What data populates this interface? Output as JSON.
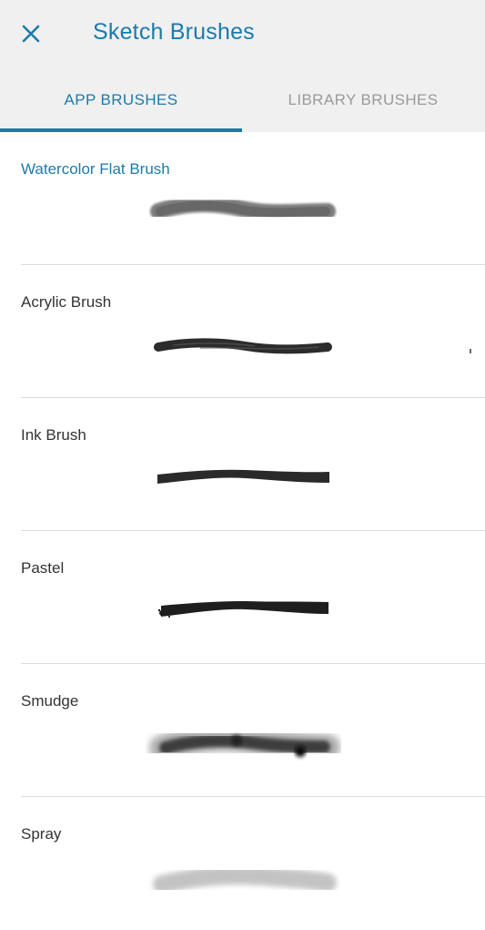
{
  "header": {
    "title": "Sketch Brushes",
    "close_icon": "close-icon"
  },
  "tabs": [
    {
      "label": "APP BRUSHES",
      "active": true
    },
    {
      "label": "LIBRARY BRUSHES",
      "active": false
    }
  ],
  "brushes": [
    {
      "name": "Watercolor Flat Brush",
      "selected": true
    },
    {
      "name": "Acrylic Brush",
      "selected": false
    },
    {
      "name": "Ink Brush",
      "selected": false
    },
    {
      "name": "Pastel",
      "selected": false
    },
    {
      "name": "Smudge",
      "selected": false
    },
    {
      "name": "Spray",
      "selected": false
    }
  ],
  "colors": {
    "accent": "#1b7bab",
    "header_bg": "#f0f0f0",
    "inactive_tab": "#9a9a9a",
    "text": "#333333",
    "divider": "#dcdcdc"
  }
}
